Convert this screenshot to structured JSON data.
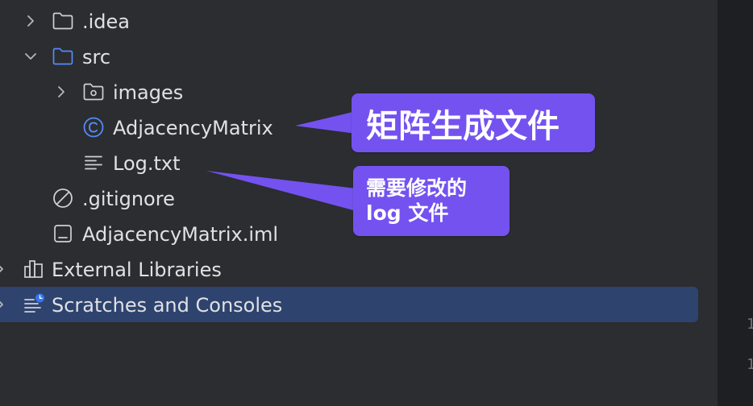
{
  "tree": {
    "items": [
      {
        "label": ".idea",
        "icon": "folder-icon",
        "expanded": false
      },
      {
        "label": "src",
        "icon": "source-folder-icon",
        "expanded": true
      },
      {
        "label": "images",
        "icon": "resource-folder-icon",
        "expanded": false
      },
      {
        "label": "AdjacencyMatrix",
        "icon": "java-class-icon"
      },
      {
        "label": "Log.txt",
        "icon": "text-file-icon"
      },
      {
        "label": ".gitignore",
        "icon": "ignored-file-icon"
      },
      {
        "label": "AdjacencyMatrix.iml",
        "icon": "module-file-icon"
      },
      {
        "label": "External Libraries",
        "icon": "libraries-icon",
        "expanded": false
      },
      {
        "label": "Scratches and Consoles",
        "icon": "scratches-icon",
        "expanded": false,
        "selected": true
      }
    ]
  },
  "annotations": {
    "class_callout": "矩阵生成文件",
    "log_callout_line1": "需要修改的",
    "log_callout_line2": "log 文件"
  },
  "editor": {
    "line_numbers": [
      "1",
      "1"
    ]
  },
  "colors": {
    "background": "#2b2d30",
    "editor_background": "#1e1f22",
    "text": "#dfe1e5",
    "selection": "#2e436e",
    "callout": "#7452f0",
    "source_folder": "#548af7",
    "class_icon": "#548af7",
    "scratch_badge": "#3574f0"
  }
}
